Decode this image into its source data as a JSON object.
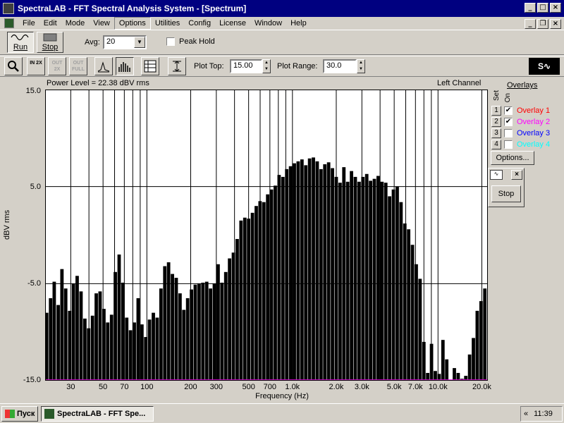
{
  "window": {
    "title": "SpectraLAB - FFT Spectral Analysis System - [Spectrum]"
  },
  "menu": [
    "File",
    "Edit",
    "Mode",
    "View",
    "Options",
    "Utilities",
    "Config",
    "License",
    "Window",
    "Help"
  ],
  "toolbar": {
    "run_label": "Run",
    "stop_label": "Stop",
    "avg_label": "Avg:",
    "avg_value": "20",
    "peak_hold_label": "Peak Hold",
    "plot_top_label": "Plot Top:",
    "plot_top_value": "15.00",
    "plot_range_label": "Plot Range:",
    "plot_range_value": "30.0",
    "btn_in2x": "IN 2X",
    "btn_out2x": "OUT 2X",
    "btn_outfull": "OUT FULL"
  },
  "plot": {
    "power_level": "Power Level = 22.38 dBV rms",
    "channel": "Left Channel",
    "y_ticks": [
      "15.0",
      "5.0",
      "-5.0",
      "-15.0"
    ],
    "x_ticks": [
      "30",
      "50",
      "70",
      "100",
      "200",
      "300",
      "500",
      "700",
      "1.0k",
      "2.0k",
      "3.0k",
      "5.0k",
      "7.0k",
      "10.0k",
      "20.0k"
    ],
    "ylabel": "dBV rms",
    "xlabel": "Frequency (Hz)"
  },
  "chart_data": {
    "type": "bar",
    "ylim": [
      -15,
      15
    ],
    "xscale": "log",
    "xlim": [
      20,
      22000
    ],
    "grid": true,
    "points": [
      [
        20.5,
        -8.0
      ],
      [
        21.8,
        -6.5
      ],
      [
        23.1,
        -4.8
      ],
      [
        24.6,
        -7.2
      ],
      [
        26.1,
        -3.5
      ],
      [
        27.7,
        -5.5
      ],
      [
        29.5,
        -7.8
      ],
      [
        31.3,
        -5.0
      ],
      [
        33.2,
        -4.2
      ],
      [
        35.3,
        -5.8
      ],
      [
        37.5,
        -8.6
      ],
      [
        39.8,
        -9.6
      ],
      [
        42.3,
        -8.3
      ],
      [
        44.9,
        -6.0
      ],
      [
        47.7,
        -5.8
      ],
      [
        50.7,
        -7.6
      ],
      [
        53.8,
        -9.0
      ],
      [
        57.2,
        -8.2
      ],
      [
        60.7,
        -3.8
      ],
      [
        64.5,
        -2.0
      ],
      [
        68.5,
        -4.9
      ],
      [
        72.7,
        -8.5
      ],
      [
        77.2,
        -9.8
      ],
      [
        82.0,
        -9.0
      ],
      [
        87.1,
        -6.5
      ],
      [
        92.5,
        -9.2
      ],
      [
        98.2,
        -10.5
      ],
      [
        104.3,
        -8.7
      ],
      [
        110.8,
        -8.0
      ],
      [
        117.7,
        -8.5
      ],
      [
        125.0,
        -5.5
      ],
      [
        132.8,
        -3.2
      ],
      [
        141.0,
        -2.8
      ],
      [
        149.8,
        -4.0
      ],
      [
        159.1,
        -4.4
      ],
      [
        169.0,
        -6.0
      ],
      [
        179.5,
        -7.7
      ],
      [
        190.6,
        -6.5
      ],
      [
        202.5,
        -5.6
      ],
      [
        215.0,
        -5.1
      ],
      [
        228.4,
        -5.0
      ],
      [
        242.6,
        -4.9
      ],
      [
        257.7,
        -4.8
      ],
      [
        273.7,
        -5.5
      ],
      [
        290.7,
        -5.0
      ],
      [
        308.7,
        -3.0
      ],
      [
        327.9,
        -4.9
      ],
      [
        348.3,
        -3.8
      ],
      [
        369.9,
        -2.4
      ],
      [
        392.9,
        -1.8
      ],
      [
        417.3,
        -0.4
      ],
      [
        443.2,
        1.5
      ],
      [
        470.8,
        1.8
      ],
      [
        500.0,
        1.7
      ],
      [
        531.1,
        2.3
      ],
      [
        564.1,
        3.0
      ],
      [
        599.1,
        3.5
      ],
      [
        636.3,
        3.4
      ],
      [
        675.9,
        4.2
      ],
      [
        717.8,
        4.7
      ],
      [
        762.4,
        5.1
      ],
      [
        809.8,
        6.2
      ],
      [
        860.1,
        6.0
      ],
      [
        913.5,
        6.8
      ],
      [
        970.3,
        7.1
      ],
      [
        1030.6,
        7.4
      ],
      [
        1094.6,
        7.6
      ],
      [
        1162.6,
        7.8
      ],
      [
        1234.8,
        7.2
      ],
      [
        1311.5,
        7.9
      ],
      [
        1393.0,
        8.0
      ],
      [
        1479.5,
        7.6
      ],
      [
        1571.4,
        6.8
      ],
      [
        1669.0,
        7.3
      ],
      [
        1772.6,
        7.5
      ],
      [
        1882.7,
        6.9
      ],
      [
        2000.0,
        6.0
      ],
      [
        2124.2,
        5.4
      ],
      [
        2256.1,
        7.0
      ],
      [
        2396.3,
        5.5
      ],
      [
        2545.1,
        6.6
      ],
      [
        2703.2,
        6.0
      ],
      [
        2871.1,
        5.5
      ],
      [
        3049.5,
        6.0
      ],
      [
        3238.9,
        6.3
      ],
      [
        3440.1,
        5.6
      ],
      [
        3653.7,
        5.8
      ],
      [
        3880.7,
        6.1
      ],
      [
        4121.7,
        5.5
      ],
      [
        4377.7,
        5.4
      ],
      [
        4649.6,
        4.0
      ],
      [
        4938.4,
        4.7
      ],
      [
        5245.2,
        5.0
      ],
      [
        5571.0,
        3.4
      ],
      [
        5917.0,
        1.2
      ],
      [
        6284.5,
        0.6
      ],
      [
        6674.9,
        -1.0
      ],
      [
        7089.5,
        -3.0
      ],
      [
        7529.8,
        -4.5
      ],
      [
        7997.5,
        -11.0
      ],
      [
        8494.3,
        -14.2
      ],
      [
        9021.9,
        -11.2
      ],
      [
        9582.3,
        -14.0
      ],
      [
        10177.5,
        -14.3
      ],
      [
        10809.7,
        -10.8
      ],
      [
        11481.1,
        -12.8
      ],
      [
        12194.3,
        -15.0
      ],
      [
        12951.7,
        -13.7
      ],
      [
        13756.2,
        -14.2
      ],
      [
        14610.7,
        -14.8
      ],
      [
        15518.2,
        -14.5
      ],
      [
        16482.1,
        -12.3
      ],
      [
        17505.9,
        -10.6
      ],
      [
        18593.3,
        -7.8
      ],
      [
        19748.2,
        -6.8
      ],
      [
        20974.9,
        -5.5
      ]
    ]
  },
  "overlays": {
    "title": "Overlays",
    "set_label": "Set",
    "on_label": "On",
    "items": [
      {
        "num": "1",
        "name": "Overlay 1",
        "checked": true,
        "color": "#ff0000"
      },
      {
        "num": "2",
        "name": "Overlay 2",
        "checked": true,
        "color": "#ff00ff"
      },
      {
        "num": "3",
        "name": "Overlay 3",
        "checked": false,
        "color": "#0000ff"
      },
      {
        "num": "4",
        "name": "Overlay 4",
        "checked": false,
        "color": "#00ffff"
      }
    ],
    "options_label": "Options...",
    "mini_stop_label": "Stop"
  },
  "taskbar": {
    "start_label": "Пуск",
    "task_label": "SpectraLAB - FFT Spe...",
    "tray_chevron": "«",
    "clock": "11:39"
  }
}
